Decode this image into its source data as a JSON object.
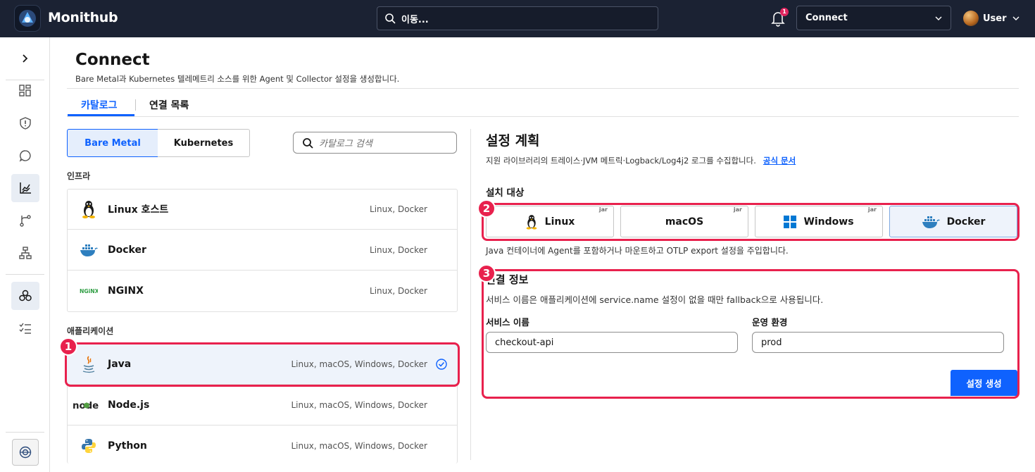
{
  "app": {
    "brand": "Monithub"
  },
  "topbar": {
    "search_placeholder": "이동...",
    "notification_count": "1",
    "connect_select": "Connect",
    "user_name": "User"
  },
  "page": {
    "title": "Connect",
    "subtitle": "Bare Metal과 Kubernetes 텔레메트리 소스를 위한 Agent 및 Collector 설정을 생성합니다."
  },
  "tabs": [
    {
      "label": "카탈로그",
      "active": true
    },
    {
      "label": "연결 목록",
      "active": false
    }
  ],
  "segments": [
    {
      "label": "Bare Metal",
      "active": true
    },
    {
      "label": "Kubernetes",
      "active": false
    }
  ],
  "catalog_search": {
    "placeholder": "카탈로그 검색"
  },
  "sections": {
    "infra": {
      "label": "인프라",
      "items": [
        {
          "name": "Linux 호스트",
          "platforms": "Linux, Docker",
          "icon": "linux-icon"
        },
        {
          "name": "Docker",
          "platforms": "Linux, Docker",
          "icon": "docker-icon"
        },
        {
          "name": "NGINX",
          "platforms": "Linux, Docker",
          "icon": "nginx-icon"
        }
      ]
    },
    "apps": {
      "label": "애플리케이션",
      "items": [
        {
          "name": "Java",
          "platforms": "Linux, macOS, Windows, Docker",
          "icon": "java-icon",
          "selected": true
        },
        {
          "name": "Node.js",
          "platforms": "Linux, macOS, Windows, Docker",
          "icon": "nodejs-icon"
        },
        {
          "name": "Python",
          "platforms": "Linux, macOS, Windows, Docker",
          "icon": "python-icon"
        }
      ]
    }
  },
  "plan": {
    "title": "설정 계획",
    "desc": "지원 라이브러리의 트레이스·JVM 메트릭·Logback/Log4j2 로그를 수집합니다.",
    "link": "공식 문서",
    "target_label": "설치 대상",
    "targets": [
      {
        "label": "Linux",
        "tag": "jar",
        "icon": "linux-icon"
      },
      {
        "label": "macOS",
        "tag": "jar",
        "icon": ""
      },
      {
        "label": "Windows",
        "tag": "jar",
        "icon": "windows-icon"
      },
      {
        "label": "Docker",
        "tag": "",
        "icon": "docker-icon",
        "selected": true
      }
    ],
    "target_note": "Java 컨테이너에 Agent를 포함하거나 마운트하고 OTLP export 설정을 주입합니다."
  },
  "connection": {
    "title": "연결 정보",
    "desc": "서비스 이름은 애플리케이션에 service.name 설정이 없을 때만 fallback으로 사용됩니다.",
    "service_label": "서비스 이름",
    "service_value": "checkout-api",
    "env_label": "운영 환경",
    "env_value": "prod",
    "generate_button": "설정 생성"
  },
  "annotations": [
    "1",
    "2",
    "3"
  ],
  "colors": {
    "topbar": "#1b2233",
    "accent": "#0f62fe",
    "highlight": "#e8214d"
  }
}
